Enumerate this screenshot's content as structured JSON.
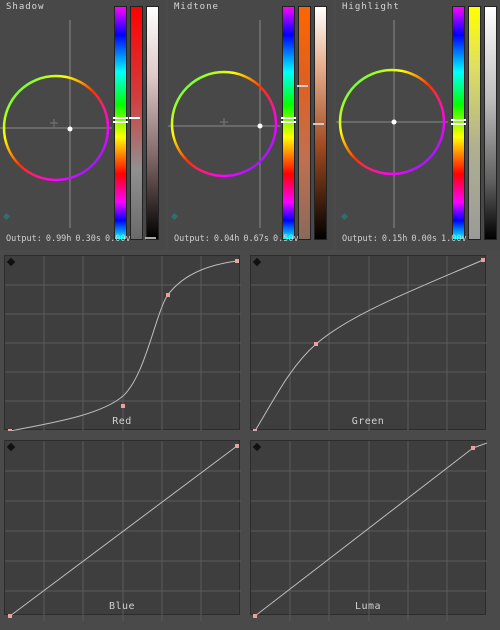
{
  "colors": {
    "accent_point": "#e8a0a0",
    "grid": "#5a5a5a",
    "curve": "#bdbdbd"
  },
  "wheels": [
    {
      "title": "Shadow",
      "output_label": "Output:",
      "output_h": "0.99h",
      "output_s": "0.30s",
      "output_v": "0.00v"
    },
    {
      "title": "Midtone",
      "output_label": "Output:",
      "output_h": "0.04h",
      "output_s": "0.67s",
      "output_v": "0.50v"
    },
    {
      "title": "Highlight",
      "output_label": "Output:",
      "output_h": "0.15h",
      "output_s": "0.00s",
      "output_v": "1.00v"
    }
  ],
  "curves": [
    {
      "label": "Red"
    },
    {
      "label": "Green"
    },
    {
      "label": "Blue"
    },
    {
      "label": "Luma"
    }
  ],
  "icons": {
    "panel_toggle": "diamond-icon",
    "reset": "diamond-icon"
  }
}
